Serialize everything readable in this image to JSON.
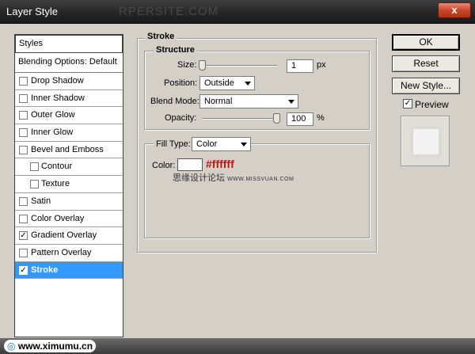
{
  "window": {
    "title": "Layer Style",
    "watermark": "RPERSITE.COM",
    "close_label": "x"
  },
  "styles_list": {
    "header": "Styles",
    "blending": "Blending Options: Default",
    "items": [
      {
        "label": "Drop Shadow",
        "checked": ""
      },
      {
        "label": "Inner Shadow",
        "checked": ""
      },
      {
        "label": "Outer Glow",
        "checked": ""
      },
      {
        "label": "Inner Glow",
        "checked": ""
      },
      {
        "label": "Bevel and Emboss",
        "checked": ""
      },
      {
        "label": "Contour",
        "checked": ""
      },
      {
        "label": "Texture",
        "checked": ""
      },
      {
        "label": "Satin",
        "checked": ""
      },
      {
        "label": "Color Overlay",
        "checked": ""
      },
      {
        "label": "Gradient Overlay",
        "checked": "✓"
      },
      {
        "label": "Pattern Overlay",
        "checked": ""
      },
      {
        "label": "Stroke",
        "checked": "✓"
      }
    ]
  },
  "stroke": {
    "title": "Stroke",
    "structure_title": "Structure",
    "size_label": "Size:",
    "size_value": "1",
    "size_unit": "px",
    "position_label": "Position:",
    "position_value": "Outside",
    "blend_label": "Blend Mode:",
    "blend_value": "Normal",
    "opacity_label": "Opacity:",
    "opacity_value": "100",
    "opacity_unit": "%",
    "filltype_label": "Fill Type:",
    "filltype_value": "Color",
    "color_label": "Color:",
    "color_hex": "#ffffff",
    "color_swatch": "#ffffff",
    "annotation": "#ffffff",
    "forum_watermark": "思缘设计论坛",
    "forum_url": "WWW.MISSVUAN.COM"
  },
  "buttons": {
    "ok": "OK",
    "reset": "Reset",
    "new_style": "New Style...",
    "preview_label": "Preview",
    "preview_checked": "✓"
  },
  "footer": {
    "site": "www.ximumu.cn"
  }
}
